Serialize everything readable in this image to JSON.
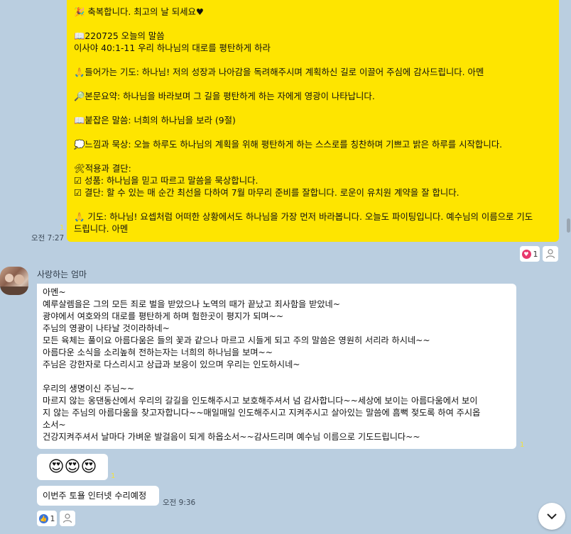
{
  "my_message": {
    "lines": [
      "🎉 축복합니다. 최고의 날 되세요♥",
      "",
      "📖220725 오늘의 말씀",
      "이사야 40:1-11 우리 하나님의 대로를 평탄하게 하라",
      "",
      "🙏들어가는 기도: 하나님! 저의 성장과 나아감을 독려해주시며 계획하신 길로 이끌어 주심에 감사드립니다. 아멘",
      "",
      "🔎본문요약: 하나님을 바라보며 그 길을 평탄하게 하는 자에게 영광이 나타납니다.",
      "",
      "📖붙잡은 말씀: 너희의 하나님을 보라 (9절)",
      "",
      "💭느낌과 묵상: 오늘 하루도 하나님의 계획을 위해 평탄하게 하는 스스로를 칭찬하며 기쁘고 밝은 하루를 시작합니다.",
      "",
      "🛠적용과 결단:",
      "☑ 성품: 하나님을 믿고 따르고 말씀을 묵상합니다.",
      "☑ 결단: 할 수 있는 매 순간 최선을 다하여 7월 마무리 준비를 잘합니다. 로운이 유치원 계약을 잘 합니다.",
      "",
      "🙏 기도: 하나님! 요셉처럼 어떠한 상황에서도 하나님을 가장 먼저 바라봅니다. 오늘도 파이팅입니다. 예수님의 이름으로 기도",
      "드립니다. 아멘"
    ],
    "read_count": "1",
    "time": "오전 7:27",
    "reaction_count": "1"
  },
  "sender_name": "사랑하는 엄마",
  "their_messages": {
    "reply_lines": [
      "아멘~",
      "예루살렘을은 그의 모든 죄로 벌을 받았으나 노역의 때가 끝났고 죄사함을 받았네~",
      "광야에서 여호와의 대로를 평탄하게 하며 험한곳이 평지가 되며~~",
      "주님의 영광이 나타날 것이라하네~",
      "모든 육체는 풀이요 아름다움은 들의 꽃과 같으나 마르고 시들게 되고 주의 말씀은 영원히 서리라 하시네~~",
      "아름다운 소식을 소리높혀 전하는자는 너희의 하나님을 보며~~",
      "주님은 강한자로 다스리시고 상급과 보응이 있으며 우리는 인도하시네~",
      "",
      "우리의 생명이신 주님~~",
      "마르지 않는 옹댄동산에서 우리의 갈길을 인도해주시고 보호해주셔서 넘 감사합니다~~세상에 보이는 아름다움에서 보이",
      "지 않는 주님의 아름다움을 찾고자합니다~~매일매일 인도해주시고 지켜주시고 살아있는 말씀에 흠뻑 젖도록 하여 주시옵",
      "소서~",
      "건강지켜주셔서 날마다 가벼운 발걸음이 되게 하옵소서~~감사드리며 예수님 이름으로 기도드립니다~~"
    ],
    "reply_read_count": "1",
    "emoji_message": "😍😍😍",
    "emoji_read_count": "1",
    "repair_message": "이번주 토욜 인터넷 수리예정",
    "time": "오전 9:36",
    "reaction_count": "1"
  },
  "colors": {
    "background": "#bacee0",
    "my_bubble": "#fee500",
    "their_bubble": "#ffffff",
    "heart_reaction": "#e8386d",
    "like_reaction": "#3a73d8"
  },
  "icons": {
    "heart_reaction": "heart-icon",
    "like_reaction": "thumbs-up-icon",
    "add_reaction": "person-icon",
    "scroll_down": "chevron-down-icon"
  }
}
